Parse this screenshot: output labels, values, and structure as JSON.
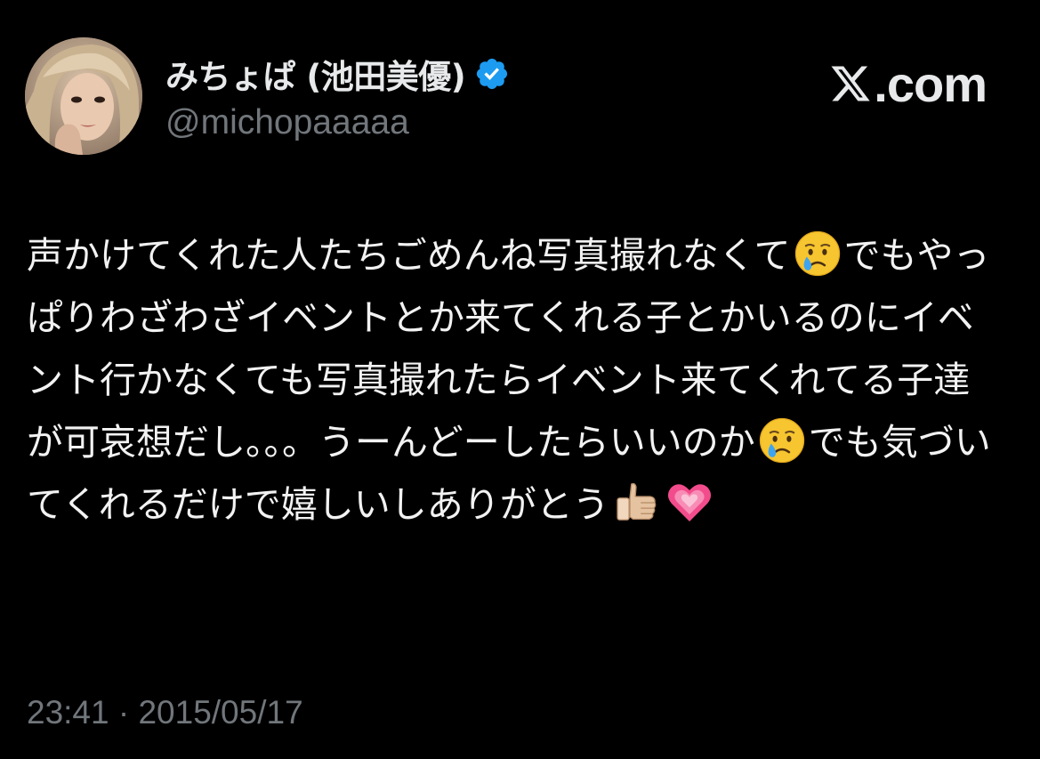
{
  "author": {
    "display_name": "みちょぱ (池田美優)",
    "handle": "@michopaaaaa",
    "verified": true,
    "verified_color": "#1d9bf0"
  },
  "brand": {
    "text": ".com",
    "logo_icon": "x-logo-icon"
  },
  "tweet": {
    "segments": [
      {
        "type": "text",
        "value": "声かけてくれた人たちごめんね写真撮れなくて"
      },
      {
        "type": "emoji",
        "name": "crying-face-icon"
      },
      {
        "type": "text",
        "value": "でもやっぱりわざわざイベントとか来てくれる子とかいるのにイベント行かなくても写真撮れたらイベント来てくれてる子達が可哀想だし。。。うーんどーしたらいいのか"
      },
      {
        "type": "emoji",
        "name": "crying-face-icon"
      },
      {
        "type": "text",
        "value": "でも気づいてくれるだけで嬉しいしありがとう"
      },
      {
        "type": "emoji",
        "name": "thumbs-up-icon"
      },
      {
        "type": "emoji",
        "name": "growing-heart-icon"
      }
    ]
  },
  "timestamp": "23:41 · 2015/05/17",
  "colors": {
    "background": "#000000",
    "primary_text": "#e7e9ea",
    "secondary_text": "#71767b"
  }
}
